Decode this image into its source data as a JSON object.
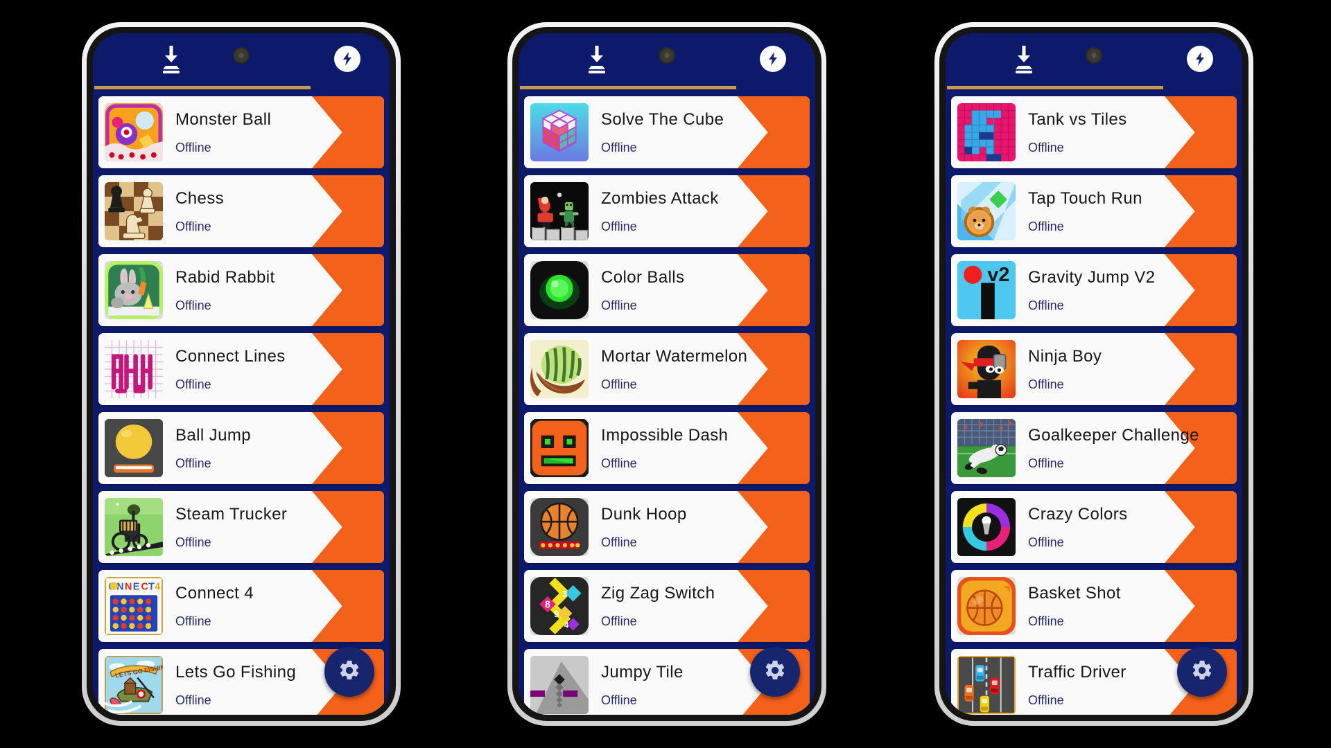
{
  "app": {
    "accent_orange": "#f4611a",
    "background_navy": "#0d1a6b",
    "divider_gold": "#c79a4e",
    "fab_navy": "#16256e",
    "status_text": "Offline"
  },
  "topbar": {
    "download_icon": "download-to-tray-icon",
    "camera_notch": "camera-notch",
    "bolt_icon": "lightning-bolt-icon"
  },
  "fab": {
    "label": "gear-icon",
    "name": "settings-button"
  },
  "phones": [
    {
      "id": "phone-1",
      "items": [
        {
          "title": "Monster Ball",
          "status": "Offline",
          "icon": "monster-ball-icon"
        },
        {
          "title": "Chess",
          "status": "Offline",
          "icon": "chess-icon"
        },
        {
          "title": "Rabid Rabbit",
          "status": "Offline",
          "icon": "rabid-rabbit-icon"
        },
        {
          "title": "Connect Lines",
          "status": "Offline",
          "icon": "connect-lines-icon"
        },
        {
          "title": "Ball Jump",
          "status": "Offline",
          "icon": "ball-jump-icon"
        },
        {
          "title": "Steam Trucker",
          "status": "Offline",
          "icon": "steam-trucker-icon"
        },
        {
          "title": "Connect 4",
          "status": "Offline",
          "icon": "connect-4-icon"
        },
        {
          "title": "Lets Go Fishing",
          "status": "Offline",
          "icon": "lets-go-fishing-icon"
        }
      ]
    },
    {
      "id": "phone-2",
      "items": [
        {
          "title": "Solve The Cube",
          "status": "Offline",
          "icon": "rubiks-cube-icon"
        },
        {
          "title": "Zombies Attack",
          "status": "Offline",
          "icon": "zombies-attack-icon"
        },
        {
          "title": "Color Balls",
          "status": "Offline",
          "icon": "color-balls-icon"
        },
        {
          "title": "Mortar Watermelon",
          "status": "Offline",
          "icon": "mortar-watermelon-icon"
        },
        {
          "title": "Impossible Dash",
          "status": "Offline",
          "icon": "impossible-dash-icon"
        },
        {
          "title": "Dunk Hoop",
          "status": "Offline",
          "icon": "dunk-hoop-icon"
        },
        {
          "title": "Zig Zag Switch",
          "status": "Offline",
          "icon": "zig-zag-switch-icon"
        },
        {
          "title": "Jumpy Tile",
          "status": "Offline",
          "icon": "jumpy-tile-icon"
        }
      ]
    },
    {
      "id": "phone-3",
      "items": [
        {
          "title": "Tank vs Tiles",
          "status": "Offline",
          "icon": "tank-vs-tiles-icon"
        },
        {
          "title": "Tap Touch Run",
          "status": "Offline",
          "icon": "tap-touch-run-icon"
        },
        {
          "title": "Gravity Jump V2",
          "status": "Offline",
          "icon": "gravity-jump-v2-icon"
        },
        {
          "title": "Ninja Boy",
          "status": "Offline",
          "icon": "ninja-boy-icon"
        },
        {
          "title": "Goalkeeper Challenge",
          "status": "Offline",
          "icon": "goalkeeper-challenge-icon"
        },
        {
          "title": "Crazy Colors",
          "status": "Offline",
          "icon": "crazy-colors-icon"
        },
        {
          "title": "Basket Shot",
          "status": "Offline",
          "icon": "basket-shot-icon"
        },
        {
          "title": "Traffic Driver",
          "status": "Offline",
          "icon": "traffic-driver-icon"
        }
      ]
    }
  ]
}
